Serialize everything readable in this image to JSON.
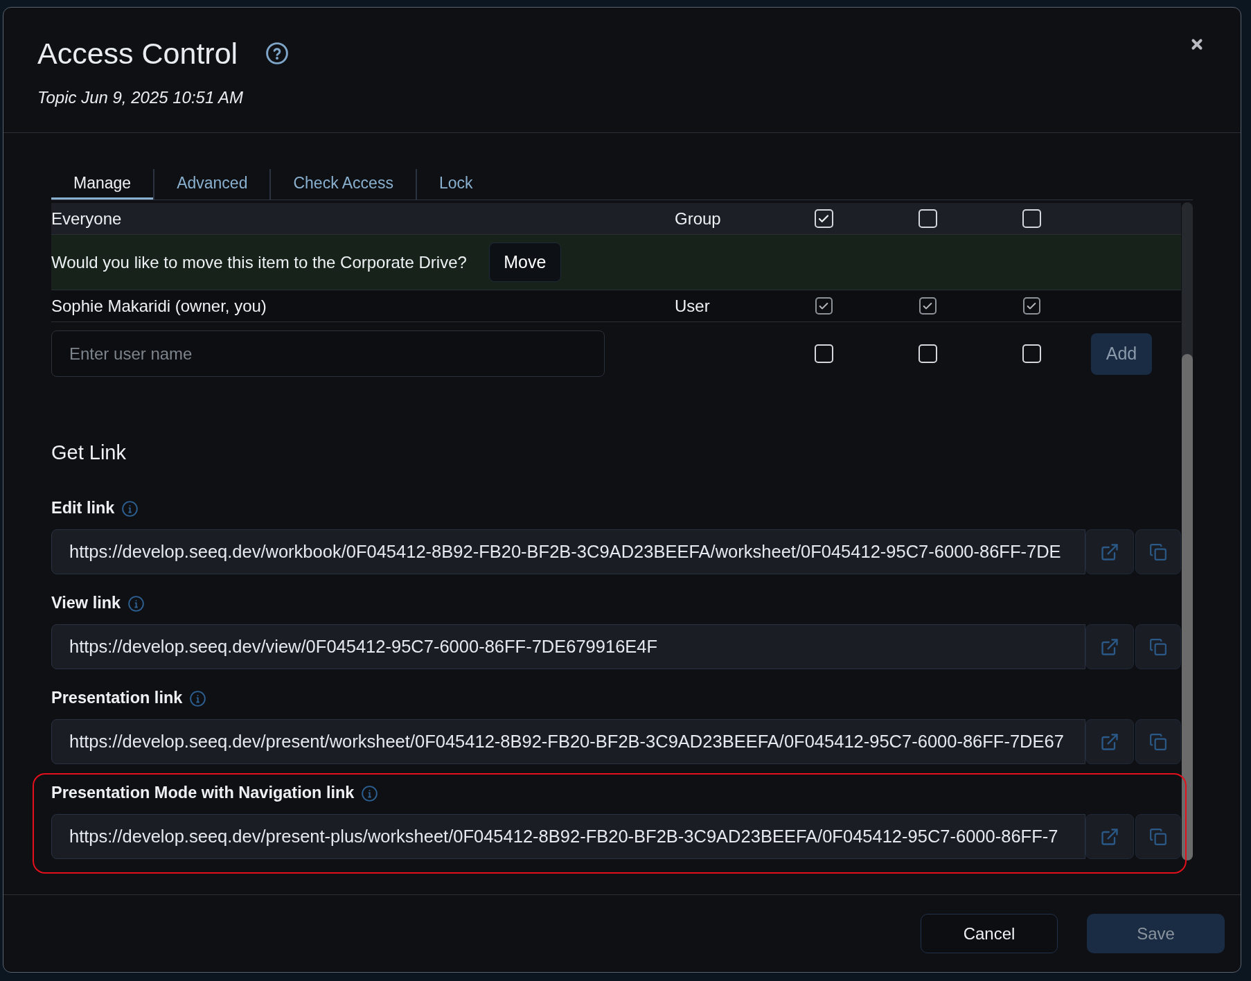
{
  "dialog": {
    "title": "Access Control",
    "subtitle": "Topic Jun 9, 2025 10:51 AM"
  },
  "tabs": [
    {
      "label": "Manage",
      "selected": true
    },
    {
      "label": "Advanced",
      "selected": false
    },
    {
      "label": "Check Access",
      "selected": false
    },
    {
      "label": "Lock",
      "selected": false
    }
  ],
  "access_rows": [
    {
      "kind": "entry",
      "name": "Everyone",
      "type": "Group",
      "permissions": [
        {
          "checked": true,
          "disabled": false
        },
        {
          "checked": false,
          "disabled": false
        },
        {
          "checked": false,
          "disabled": false
        }
      ]
    },
    {
      "kind": "notice",
      "text": "Would you like to move this item to the Corporate Drive?",
      "button": "Move"
    },
    {
      "kind": "entry",
      "name": "Sophie Makaridi (owner, you)",
      "type": "User",
      "permissions": [
        {
          "checked": true,
          "disabled": true
        },
        {
          "checked": true,
          "disabled": true
        },
        {
          "checked": true,
          "disabled": true
        }
      ]
    }
  ],
  "new_user": {
    "placeholder": "Enter user name",
    "permissions": [
      {
        "checked": false,
        "disabled": false
      },
      {
        "checked": false,
        "disabled": false
      },
      {
        "checked": false,
        "disabled": false
      }
    ],
    "button": {
      "label": "Add",
      "disabled": true
    }
  },
  "get_link": {
    "heading": "Get Link",
    "links": [
      {
        "label": "Edit link",
        "url": "https://develop.seeq.dev/workbook/0F045412-8B92-FB20-BF2B-3C9AD23BEEFA/worksheet/0F045412-95C7-6000-86FF-7DE",
        "highlighted": false
      },
      {
        "label": "View link",
        "url": "https://develop.seeq.dev/view/0F045412-95C7-6000-86FF-7DE679916E4F",
        "highlighted": false
      },
      {
        "label": "Presentation link",
        "url": "https://develop.seeq.dev/present/worksheet/0F045412-8B92-FB20-BF2B-3C9AD23BEEFA/0F045412-95C7-6000-86FF-7DE67",
        "highlighted": false
      },
      {
        "label": "Presentation Mode with Navigation link",
        "url": "https://develop.seeq.dev/present-plus/worksheet/0F045412-8B92-FB20-BF2B-3C9AD23BEEFA/0F045412-95C7-6000-86FF-7",
        "highlighted": true
      }
    ]
  },
  "footer": {
    "buttons": [
      {
        "label": "Cancel",
        "kind": "secondary",
        "disabled": false
      },
      {
        "label": "Save",
        "kind": "primary",
        "disabled": true
      }
    ]
  }
}
